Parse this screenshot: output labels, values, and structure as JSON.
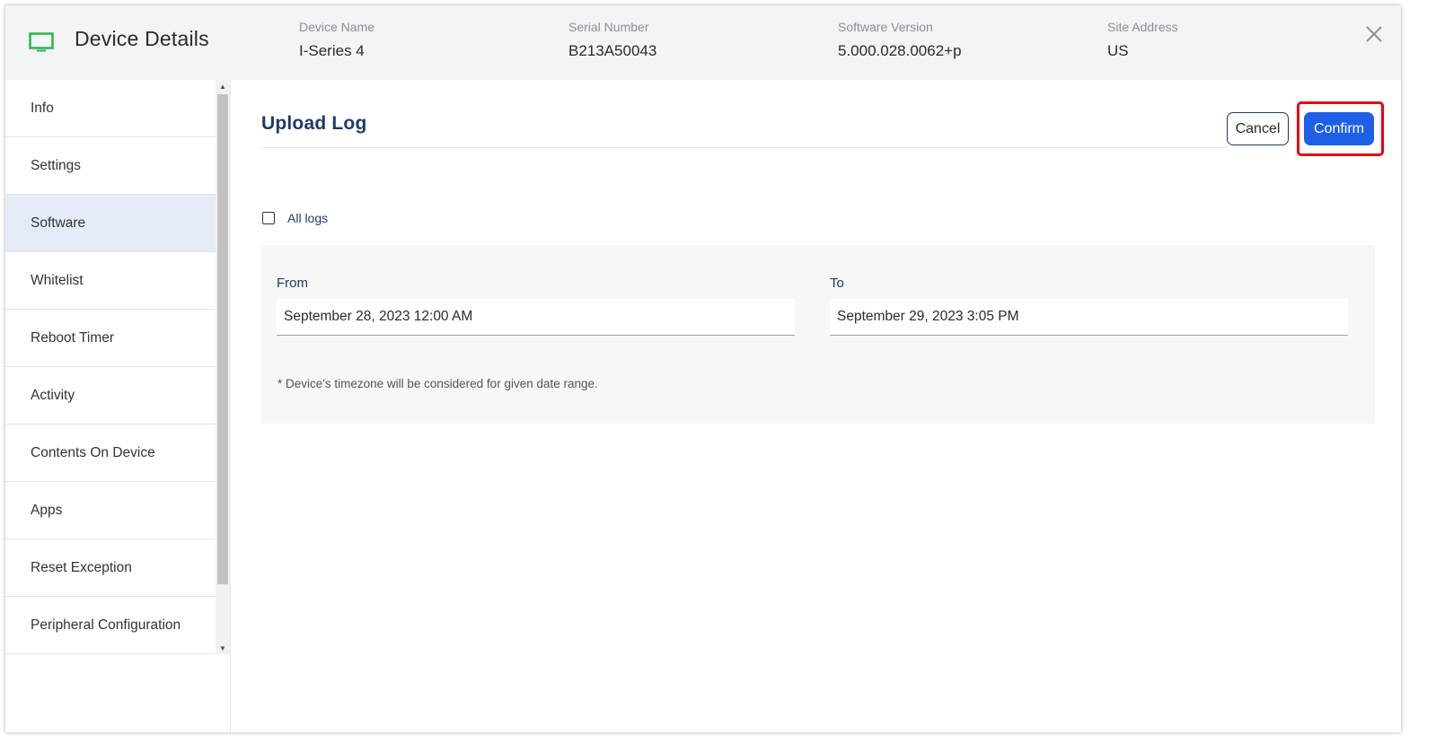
{
  "header": {
    "title": "Device Details",
    "fields": [
      {
        "label": "Device Name",
        "value": "I-Series 4"
      },
      {
        "label": "Serial Number",
        "value": "B213A50043"
      },
      {
        "label": "Software Version",
        "value": "5.000.028.0062+p"
      },
      {
        "label": "Site Address",
        "value": "US"
      }
    ],
    "icon": "monitor-icon",
    "close_icon": "close-icon"
  },
  "sidebar": {
    "items": [
      {
        "label": "Info"
      },
      {
        "label": "Settings"
      },
      {
        "label": "Software",
        "active": true
      },
      {
        "label": "Whitelist"
      },
      {
        "label": "Reboot Timer"
      },
      {
        "label": "Activity"
      },
      {
        "label": "Contents On Device"
      },
      {
        "label": "Apps"
      },
      {
        "label": "Reset Exception"
      },
      {
        "label": "Peripheral Configuration"
      }
    ]
  },
  "panel": {
    "title": "Upload Log",
    "cancel_label": "Cancel",
    "confirm_label": "Confirm",
    "all_logs_label": "All logs",
    "all_logs_checked": false,
    "from_label": "From",
    "from_value": "September 28, 2023 12:00 AM",
    "to_label": "To",
    "to_value": "September 29, 2023 3:05 PM",
    "note": "* Device's timezone will be considered for given date range."
  },
  "colors": {
    "accent": "#1f5fe8",
    "title": "#1f3a68",
    "highlight": "#e60012",
    "monitor_icon": "#2bb54a",
    "active_nav": "#e6ebf8"
  }
}
